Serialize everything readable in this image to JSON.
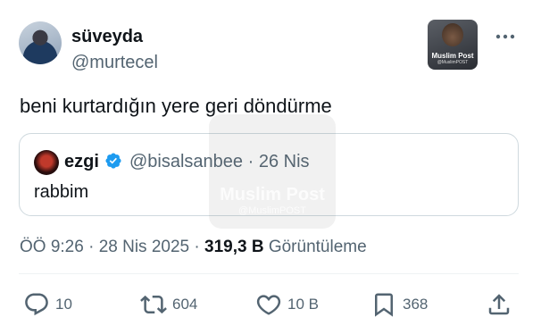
{
  "author": {
    "name": "süveyda",
    "handle": "@murtecel"
  },
  "badge": {
    "title": "Muslim Post",
    "subtitle": "@MuslimPOST"
  },
  "tweet": {
    "text": "beni kurtardığın yere geri döndürme"
  },
  "quote": {
    "name": "ezgi",
    "handle_date": "@bisalsanbee · 26 Nis",
    "text": "rabbim"
  },
  "watermark": {
    "title": "Muslim Post",
    "subtitle": "@MuslimPOST"
  },
  "meta": {
    "time_date": "ÖÖ 9:26 · 28 Nis 2025 · ",
    "views_count": "319,3 B",
    "views_label": " Görüntüleme"
  },
  "actions": {
    "reply_count": "10",
    "retweet_count": "604",
    "like_count": "10 B",
    "bookmark_count": "368"
  },
  "colors": {
    "primary_text": "#0f1419",
    "secondary_text": "#536471",
    "verified_blue": "#1d9bf0",
    "border": "#cfd9de"
  }
}
